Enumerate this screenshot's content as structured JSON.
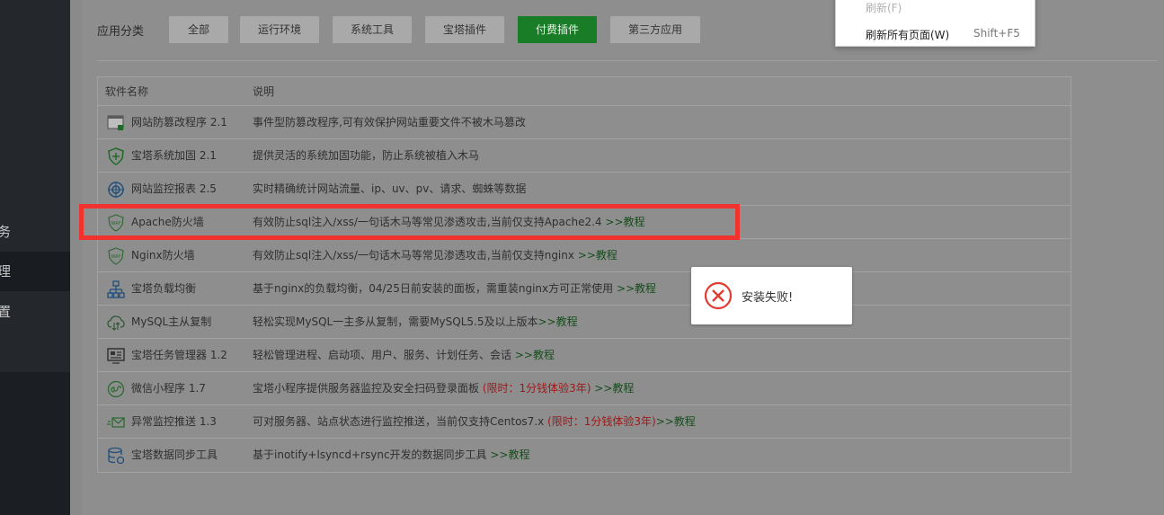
{
  "sidebar": {
    "items": [
      {
        "label": "务"
      },
      {
        "label": "理"
      },
      {
        "label": "置"
      }
    ]
  },
  "categories": {
    "label": "应用分类",
    "buttons": [
      {
        "label": "全部"
      },
      {
        "label": "运行环境"
      },
      {
        "label": "系统工具"
      },
      {
        "label": "宝塔插件"
      },
      {
        "label": "付费插件"
      },
      {
        "label": "第三方应用"
      }
    ],
    "active_index": 4
  },
  "table": {
    "headers": {
      "name": "软件名称",
      "desc": "说明"
    },
    "rows": [
      {
        "icon": "tamper-proof-icon",
        "name": "网站防篡改程序 2.1",
        "desc": "事件型防篡改程序,可有效保护网站重要文件不被木马篡改",
        "limited": "",
        "link": ""
      },
      {
        "icon": "shield-plus-icon",
        "name": "宝塔系统加固 2.1",
        "desc": "提供灵活的系统加固功能，防止系统被植入木马",
        "limited": "",
        "link": ""
      },
      {
        "icon": "monitor-target-icon",
        "name": "网站监控报表 2.5",
        "desc": "实时精确统计网站流量、ip、uv、pv、请求、蜘蛛等数据",
        "limited": "",
        "link": ""
      },
      {
        "icon": "waf-shield-icon",
        "name": "Apache防火墙",
        "desc": "有效防止sql注入/xss/一句话木马等常见渗透攻击,当前仅支持Apache2.4 ",
        "limited": "",
        "link": ">>教程"
      },
      {
        "icon": "waf-shield-icon",
        "name": "Nginx防火墙",
        "desc": "有效防止sql注入/xss/一句话木马等常见渗透攻击,当前仅支持nginx ",
        "limited": "",
        "link": ">>教程"
      },
      {
        "icon": "network-tree-icon",
        "name": "宝塔负载均衡",
        "desc": "基于nginx的负载均衡，04/25日前安装的面板，需重装nginx方可正常使用 ",
        "limited": "",
        "link": ">>教程"
      },
      {
        "icon": "cloud-sync-icon",
        "name": "MySQL主从复制",
        "desc": "轻松实现MySQL一主多从复制，需要MySQL5.5及以上版本",
        "limited": "",
        "link": ">>教程"
      },
      {
        "icon": "task-manager-icon",
        "name": "宝塔任务管理器 1.2",
        "desc": "轻松管理进程、启动项、用户、服务、计划任务、会话 ",
        "limited": "",
        "link": ">>教程"
      },
      {
        "icon": "wechat-miniapp-icon",
        "name": "微信小程序 1.7",
        "desc": "宝塔小程序提供服务器监控及安全扫码登录面板 ",
        "limited": "(限时：1分钱体验3年)",
        "link": " >>教程"
      },
      {
        "icon": "mail-send-icon",
        "name": "异常监控推送 1.3",
        "desc": "可对服务器、站点状态进行监控推送，当前仅支持Centos7.x ",
        "limited": "(限时：1分钱体验3年)",
        "link": ">>教程"
      },
      {
        "icon": "database-sync-icon",
        "name": "宝塔数据同步工具",
        "desc": "基于inotify+lsyncd+rsync开发的数据同步工具 ",
        "limited": "",
        "link": ">>教程"
      }
    ]
  },
  "toast": {
    "message": "安装失败!"
  },
  "context_menu": {
    "items": [
      {
        "label": "刷新(F)",
        "shortcut": "",
        "disabled": true
      },
      {
        "label": "刷新所有页面(W)",
        "shortcut": "Shift+F5",
        "disabled": false
      }
    ]
  }
}
